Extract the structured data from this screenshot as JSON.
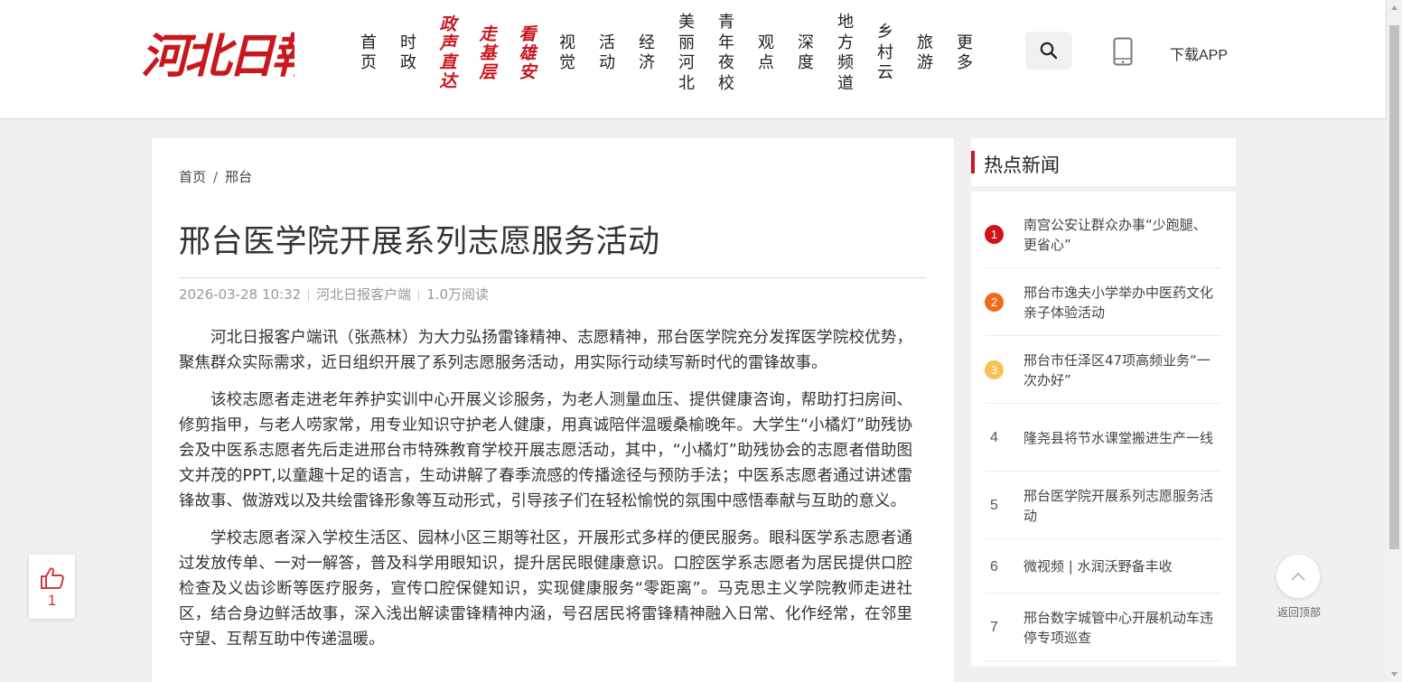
{
  "site": {
    "logo_text": "河北日報"
  },
  "nav": {
    "items": [
      {
        "label": "首页",
        "special": false
      },
      {
        "label": "时政",
        "special": false
      },
      {
        "label": "政声直达",
        "special": true
      },
      {
        "label": "走基层",
        "special": true
      },
      {
        "label": "看雄安",
        "special": true
      },
      {
        "label": "视觉",
        "special": false
      },
      {
        "label": "活动",
        "special": false
      },
      {
        "label": "经济",
        "special": false
      },
      {
        "label": "美丽河北",
        "special": false
      },
      {
        "label": "青年夜校",
        "special": false
      },
      {
        "label": "观点",
        "special": false
      },
      {
        "label": "深度",
        "special": false
      },
      {
        "label": "地方频道",
        "special": false
      },
      {
        "label": "乡村云",
        "special": false
      },
      {
        "label": "旅游",
        "special": false
      },
      {
        "label": "更多",
        "special": false
      }
    ],
    "download_label": "下载APP"
  },
  "breadcrumb": {
    "home": "首页",
    "separator": "/",
    "current": "邢台"
  },
  "article": {
    "title": "邢台医学院开展系列志愿服务活动",
    "date": "2026-03-28 10:32",
    "source": "河北日报客户端",
    "reads": "1.0万阅读",
    "paragraphs": [
      "河北日报客户端讯（张燕林）为大力弘扬雷锋精神、志愿精神，邢台医学院充分发挥医学院校优势，聚焦群众实际需求，近日组织开展了系列志愿服务活动，用实际行动续写新时代的雷锋故事。",
      "该校志愿者走进老年养护实训中心开展义诊服务，为老人测量血压、提供健康咨询，帮助打扫房间、修剪指甲，与老人唠家常，用专业知识守护老人健康，用真诚陪伴温暖桑榆晚年。大学生“小橘灯”助残协会及中医系志愿者先后走进邢台市特殊教育学校开展志愿活动，其中，“小橘灯”助残协会的志愿者借助图文并茂的PPT,以童趣十足的语言，生动讲解了春季流感的传播途径与预防手法；中医系志愿者通过讲述雷锋故事、做游戏以及共绘雷锋形象等互动形式，引导孩子们在轻松愉悦的氛围中感悟奉献与互助的意义。",
      "学校志愿者深入学校生活区、园林小区三期等社区，开展形式多样的便民服务。眼科医学系志愿者通过发放传单、一对一解答，普及科学用眼知识，提升居民眼健康意识。口腔医学系志愿者为居民提供口腔检查及义齿诊断等医疗服务，宣传口腔保健知识，实现健康服务“零距离”。马克思主义学院教师走进社区，结合身边鲜活故事，深入浅出解读雷锋精神内涵，号召居民将雷锋精神融入日常、化作经常，在邻里守望、互帮互助中传递温暖。"
    ]
  },
  "hot_news": {
    "heading": "热点新闻",
    "items": [
      {
        "rank": "1",
        "text": "南宫公安让群众办事“少跑腿、更省心”",
        "color": "#d0141b"
      },
      {
        "rank": "2",
        "text": "邢台市逸夫小学举办中医药文化亲子体验活动",
        "color": "#f06a1e"
      },
      {
        "rank": "3",
        "text": "邢台市任泽区47项高频业务“一次办好”",
        "color": "#f9c155"
      },
      {
        "rank": "4",
        "text": "隆尧县将节水课堂搬进生产一线",
        "color": ""
      },
      {
        "rank": "5",
        "text": "邢台医学院开展系列志愿服务活动",
        "color": ""
      },
      {
        "rank": "6",
        "text": "微视频 | 水润沃野备丰收",
        "color": ""
      },
      {
        "rank": "7",
        "text": "邢台数字城管中心开展机动车违停专项巡查",
        "color": ""
      }
    ]
  },
  "like": {
    "count": "1"
  },
  "back_to_top": {
    "label": "返回顶部"
  },
  "colors": {
    "brand_red": "#c9171e",
    "page_bg": "#f0f0f0"
  },
  "icons": {
    "search": "search-icon",
    "phone": "phone-icon",
    "like": "thumbs-up-icon",
    "back_to_top": "chevron-up-icon"
  }
}
